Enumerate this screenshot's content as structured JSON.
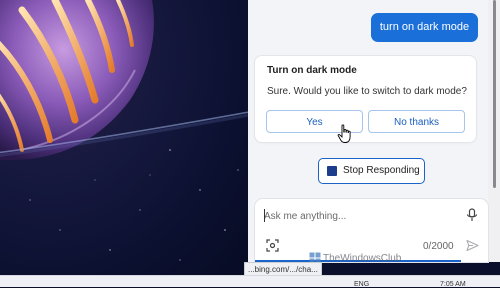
{
  "conversation": {
    "user_message": "turn on dark mode",
    "card_title": "Turn on dark mode",
    "card_body": "Sure. Would you like to switch to dark mode?",
    "yes_label": "Yes",
    "no_label": "No thanks"
  },
  "stop_button": {
    "label": "Stop Responding"
  },
  "composer": {
    "placeholder": "Ask me anything...",
    "value": "",
    "char_count": "0/2000"
  },
  "watermark": {
    "text": "TheWindowsClub"
  },
  "status_url": "...bing.com/.../cha...",
  "taskbar": {
    "language": "ENG",
    "time": "7:05 AM"
  },
  "colors": {
    "accent": "#1a6fd8",
    "stop_square": "#1c3d8c",
    "panel_bg": "#f3f4f8"
  }
}
